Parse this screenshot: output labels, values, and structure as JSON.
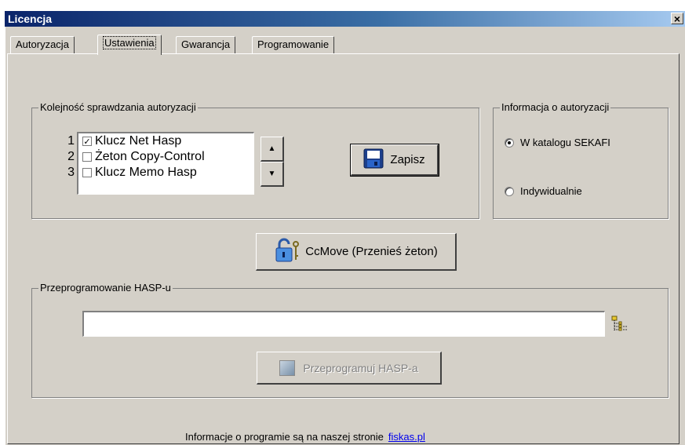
{
  "window": {
    "title": "Licencja",
    "close_symbol": "×"
  },
  "tabs": [
    {
      "label": "Autoryzacja",
      "active": false
    },
    {
      "label": "Ustawienia",
      "active": true
    },
    {
      "label": "Gwarancja",
      "active": false
    },
    {
      "label": "Programowanie",
      "active": false
    }
  ],
  "order_group": {
    "legend": "Kolejność sprawdzania autoryzacji",
    "items": [
      {
        "num": "1",
        "label": "Klucz Net Hasp",
        "checked": true
      },
      {
        "num": "2",
        "label": "Żeton Copy-Control",
        "checked": false
      },
      {
        "num": "3",
        "label": "Klucz Memo Hasp",
        "checked": false
      }
    ],
    "up_symbol": "▲",
    "down_symbol": "▼",
    "save_label": "Zapisz"
  },
  "info_group": {
    "legend": "Informacja o autoryzacji",
    "options": [
      {
        "label": "W katalogu SEKAFI",
        "selected": true
      },
      {
        "label": "Indywidualnie",
        "selected": false
      }
    ]
  },
  "ccmove_label": "CcMove (Przenieś żeton)",
  "hasp_group": {
    "legend": "Przeprogramowanie HASP-u",
    "input_value": "",
    "browse_icon": "tree-browse-icon",
    "button_label": "Przeprogramuj HASP-a"
  },
  "footer": {
    "text": "Informacje o programie są na naszej stronie",
    "link": "fiskas.pl"
  },
  "colors": {
    "face": "#d4d0c8",
    "title_start": "#0a246a",
    "title_end": "#a6caf0",
    "link": "#0000ee"
  }
}
